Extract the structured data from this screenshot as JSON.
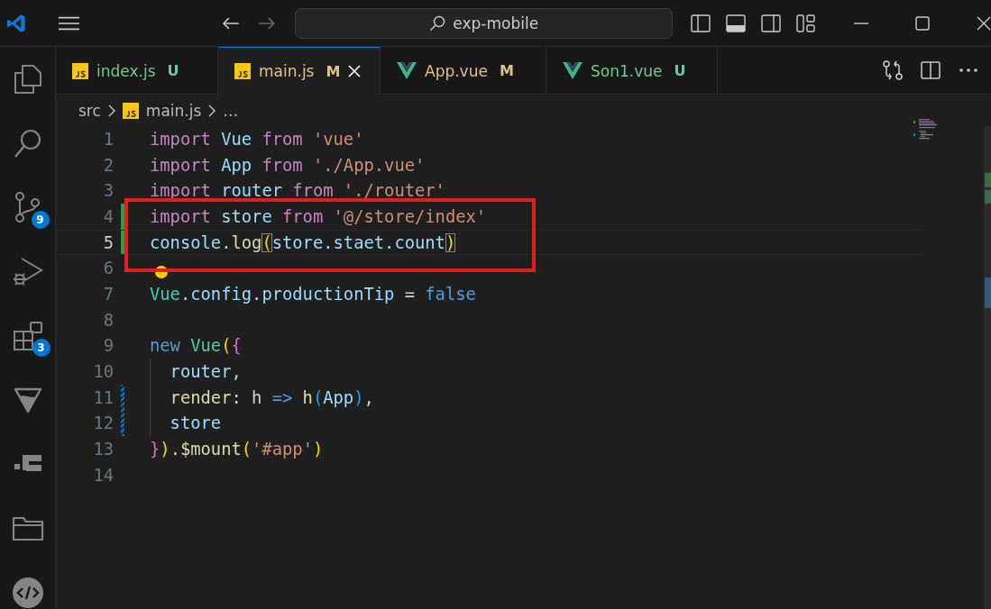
{
  "title_bar": {
    "search": "exp-mobile",
    "back_disabled": false,
    "forward_disabled": true
  },
  "activity_bar": [
    {
      "kind": "explorer"
    },
    {
      "kind": "search"
    },
    {
      "kind": "source-control",
      "badge": "9"
    },
    {
      "kind": "run-debug"
    },
    {
      "kind": "extensions",
      "badge": "3"
    },
    {
      "kind": "triangle"
    },
    {
      "kind": "blocks"
    },
    {
      "kind": "folder"
    },
    {
      "kind": "code"
    }
  ],
  "tabs": [
    {
      "label": "index.js",
      "kind": "js",
      "status": "U",
      "color": "#73c991",
      "selected": false
    },
    {
      "label": "main.js",
      "kind": "js",
      "status": "M",
      "color": "#e2c08d",
      "selected": true
    },
    {
      "label": "App.vue",
      "kind": "vue",
      "status": "M",
      "color": "#e2c08d",
      "selected": false
    },
    {
      "label": "Son1.vue",
      "kind": "vue",
      "status": "U",
      "color": "#73c991",
      "selected": false
    }
  ],
  "breadcrumb": [
    {
      "kind": "folder",
      "label": "src"
    },
    {
      "kind": "js",
      "label": "main.js"
    },
    {
      "kind": "symbol",
      "label": "…"
    }
  ],
  "code_lines": [
    {
      "number": "1",
      "current": false,
      "lightbulb": false,
      "annotated": false,
      "indent_guide": false,
      "tokens": [
        {
          "text": "import ",
          "kind": "keyword"
        },
        {
          "text": "Vue ",
          "kind": "variable"
        },
        {
          "text": "from ",
          "kind": "keyword"
        },
        {
          "text": "'vue'",
          "kind": "string"
        }
      ]
    },
    {
      "number": "2",
      "current": false,
      "lightbulb": false,
      "annotated": false,
      "indent_guide": false,
      "tokens": [
        {
          "text": "import ",
          "kind": "keyword"
        },
        {
          "text": "App ",
          "kind": "variable"
        },
        {
          "text": "from ",
          "kind": "keyword"
        },
        {
          "text": "'./App.vue'",
          "kind": "string"
        }
      ]
    },
    {
      "number": "3",
      "current": false,
      "lightbulb": false,
      "annotated": false,
      "indent_guide": false,
      "tokens": [
        {
          "text": "import ",
          "kind": "keyword"
        },
        {
          "text": "router ",
          "kind": "variable"
        },
        {
          "text": "from ",
          "kind": "keyword"
        },
        {
          "text": "'./router'",
          "kind": "string"
        }
      ]
    },
    {
      "number": "4",
      "kind": "added",
      "current": false,
      "lightbulb": false,
      "annotated": true,
      "indent_guide": false,
      "tokens": [
        {
          "text": "import ",
          "kind": "keyword"
        },
        {
          "text": "store ",
          "kind": "variable"
        },
        {
          "text": "from ",
          "kind": "keyword"
        },
        {
          "text": "'@/store/index'",
          "kind": "string"
        }
      ]
    },
    {
      "number": "5",
      "kind": "added",
      "current": true,
      "lightbulb": false,
      "annotated": true,
      "indent_guide": false,
      "tokens": [
        {
          "text": "console.",
          "kind": "variable"
        },
        {
          "text": "log",
          "kind": "function"
        },
        {
          "text": "(",
          "kind": "bracket-matched"
        },
        {
          "text": "store.staet.count",
          "kind": "variable"
        },
        {
          "text": ")",
          "kind": "bracket-matched"
        }
      ]
    },
    {
      "number": "6",
      "current": false,
      "lightbulb": true,
      "annotated": true,
      "indent_guide": false
    },
    {
      "number": "7",
      "current": false,
      "lightbulb": false,
      "annotated": false,
      "indent_guide": false,
      "tokens": [
        {
          "text": "Vue",
          "kind": "class"
        },
        {
          "text": ".config.productionTip ",
          "kind": "variable"
        },
        {
          "text": "= ",
          "kind": "plain"
        },
        {
          "text": "false",
          "kind": "constant"
        }
      ]
    },
    {
      "number": "8",
      "current": false,
      "lightbulb": false,
      "annotated": false,
      "indent_guide": false
    },
    {
      "number": "9",
      "current": false,
      "lightbulb": false,
      "annotated": false,
      "indent_guide": false,
      "tokens": [
        {
          "text": "new ",
          "kind": "constant"
        },
        {
          "text": "Vue",
          "kind": "class"
        },
        {
          "text": "(",
          "kind": "bracket1"
        },
        {
          "text": "{",
          "kind": "bracket2"
        }
      ]
    },
    {
      "number": "10",
      "current": false,
      "lightbulb": false,
      "annotated": false,
      "indent_guide": true,
      "tokens": [
        {
          "text": "router,",
          "kind": "variable"
        }
      ]
    },
    {
      "number": "11",
      "kind": "modified",
      "current": false,
      "lightbulb": false,
      "annotated": false,
      "indent_guide": true,
      "tokens": [
        {
          "text": "render",
          "kind": "function"
        },
        {
          "text": ": h ",
          "kind": "plain"
        },
        {
          "text": "=> ",
          "kind": "constant"
        },
        {
          "text": "h",
          "kind": "function"
        },
        {
          "text": "(",
          "kind": "bracket3"
        },
        {
          "text": "App",
          "kind": "variable"
        },
        {
          "text": ")",
          "kind": "bracket3"
        },
        {
          "text": ",",
          "kind": "plain"
        }
      ]
    },
    {
      "number": "12",
      "kind": "modified",
      "current": false,
      "lightbulb": false,
      "annotated": false,
      "indent_guide": true,
      "tokens": [
        {
          "text": "store",
          "kind": "variable"
        }
      ]
    },
    {
      "number": "13",
      "current": false,
      "lightbulb": false,
      "annotated": false,
      "indent_guide": false,
      "tokens": [
        {
          "text": "}",
          "kind": "bracket2"
        },
        {
          "text": ")",
          "kind": "bracket1"
        },
        {
          "text": ".$mount",
          "kind": "function"
        },
        {
          "text": "(",
          "kind": "bracket1"
        },
        {
          "text": "'#app'",
          "kind": "string"
        },
        {
          "text": ")",
          "kind": "bracket1"
        }
      ]
    },
    {
      "number": "14",
      "current": false,
      "lightbulb": false,
      "annotated": false,
      "indent_guide": false
    }
  ]
}
